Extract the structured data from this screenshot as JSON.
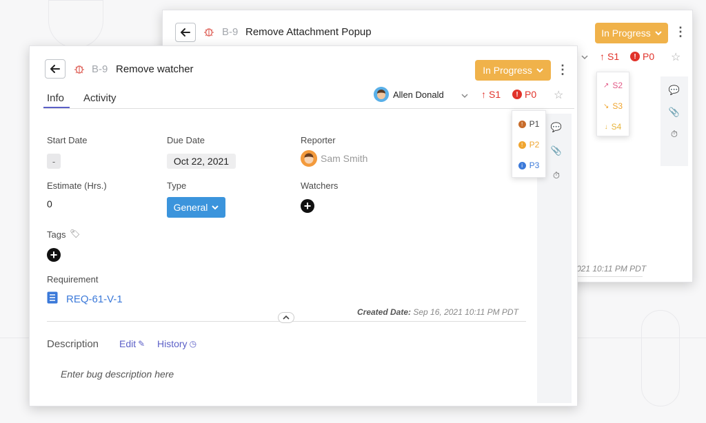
{
  "back_card": {
    "id": "B-9",
    "title": "Remove Attachment Popup",
    "status": "In Progress",
    "severity": "S1",
    "priority": "P0",
    "severity_options": [
      "S2",
      "S3",
      "S4"
    ],
    "created_partial": "021 10:11 PM PDT"
  },
  "front_card": {
    "id": "B-9",
    "title": "Remove watcher",
    "status": "In Progress",
    "tabs": [
      "Info",
      "Activity"
    ],
    "assignee": "Allen Donald",
    "severity": "S1",
    "priority": "P0",
    "priority_options": [
      "P1",
      "P2",
      "P3"
    ],
    "fields": {
      "start_date_label": "Start Date",
      "start_date_value": "-",
      "due_date_label": "Due Date",
      "due_date_value": "Oct 22, 2021",
      "reporter_label": "Reporter",
      "reporter_value": "Sam Smith",
      "estimate_label": "Estimate (Hrs.)",
      "estimate_value": "0",
      "type_label": "Type",
      "type_value": "General",
      "watchers_label": "Watchers",
      "tags_label": "Tags",
      "requirement_label": "Requirement",
      "requirement_value": "REQ-61-V-1",
      "created_label": "Created Date:",
      "created_value": "Sep 16, 2021 10:11 PM PDT"
    },
    "description": {
      "label": "Description",
      "edit": "Edit",
      "history": "History",
      "placeholder": "Enter bug description here"
    }
  },
  "colors": {
    "status": "#f0b24a",
    "severity": "#e1322a",
    "link": "#3b79d9",
    "tab_active": "#5b5fc7",
    "type_button": "#3b94dc"
  }
}
